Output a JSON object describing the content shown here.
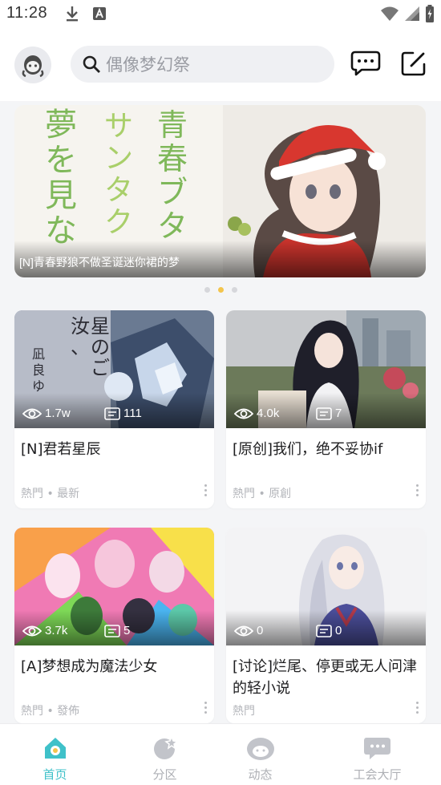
{
  "status_bar": {
    "time": "11:28",
    "download_icon": "download-icon",
    "notify_icon": "a-notification-icon"
  },
  "header": {
    "avatar_icon": "app-mascot-icon",
    "search_placeholder": "偶像梦幻祭",
    "chat_icon": "chat-bubble-icon",
    "edit_icon": "edit-icon"
  },
  "banner": {
    "caption": "[N]青春野狼不做圣诞迷你裙的梦",
    "art_text": [
      "夢を見な",
      "サンタクロ",
      "青春ブタ野"
    ],
    "page_count": 3,
    "active_page": 2
  },
  "cards": [
    {
      "views": "1.7w",
      "comments": "111",
      "title": "[N]君若星辰",
      "meta": "熱門 • 最新",
      "art_text": [
        "汝、星のごとく",
        "凪良ゆう"
      ]
    },
    {
      "views": "4.0k",
      "comments": "7",
      "title": "[原创]我们，绝不妥协if",
      "meta": "熱門 • 原創"
    },
    {
      "views": "3.7k",
      "comments": "5",
      "title": "[A]梦想成为魔法少女",
      "meta": "熱門 • 發佈"
    },
    {
      "views": "0",
      "comments": "0",
      "title": "[讨论]烂尾、停更或无人问津的轻小说",
      "meta": "熱門"
    }
  ],
  "bottom_nav": [
    {
      "label": "首页",
      "icon": "home-icon",
      "active": true
    },
    {
      "label": "分区",
      "icon": "category-icon",
      "active": false
    },
    {
      "label": "动态",
      "icon": "feed-icon",
      "active": false
    },
    {
      "label": "工会大厅",
      "icon": "guild-hall-icon",
      "active": false
    }
  ],
  "colors": {
    "accent": "#3fc1c9",
    "active_dot": "#f3c54d",
    "background": "#f4f5f7"
  }
}
